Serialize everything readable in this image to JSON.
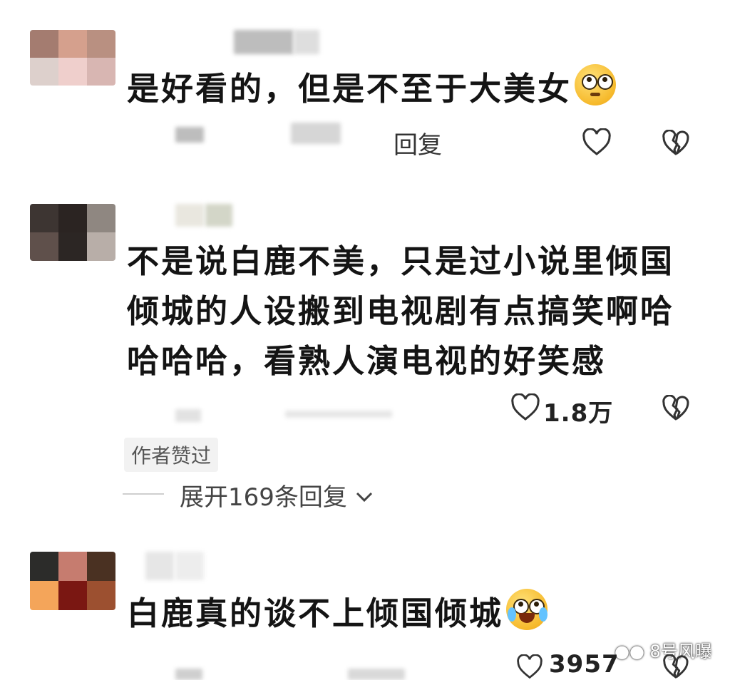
{
  "comments": [
    {
      "text": "是好看的，但是不至于大美女",
      "emoji": "flushed-face",
      "reply_label": "回复",
      "avatar_colors": [
        "#a47c70",
        "#d5a08d",
        "#b99081",
        "#ddd0cc",
        "#efcfcc",
        "#d8b6b2"
      ]
    },
    {
      "lines": [
        "不是说白鹿不美，只是过小说里倾国",
        "倾城的人设搬到电视剧有点搞笑啊哈",
        "哈哈哈，看熟人演电视的好笑感"
      ],
      "like_count": "1.8万",
      "author_badge": "作者赞过",
      "expand_label": "展开169条回复",
      "avatar_colors": [
        "#3d3532",
        "#2b2422",
        "#8f8781",
        "#5f504b",
        "#2c2624",
        "#b8aea8"
      ]
    },
    {
      "text": "白鹿真的谈不上倾国倾城",
      "emoji": "crying-face",
      "like_count": "3957",
      "avatar_colors": [
        "#2c2c2a",
        "#c67c6f",
        "#4a3122",
        "#f4a55a",
        "#7a1712",
        "#9c5030"
      ]
    }
  ],
  "watermark": "8号风曝"
}
